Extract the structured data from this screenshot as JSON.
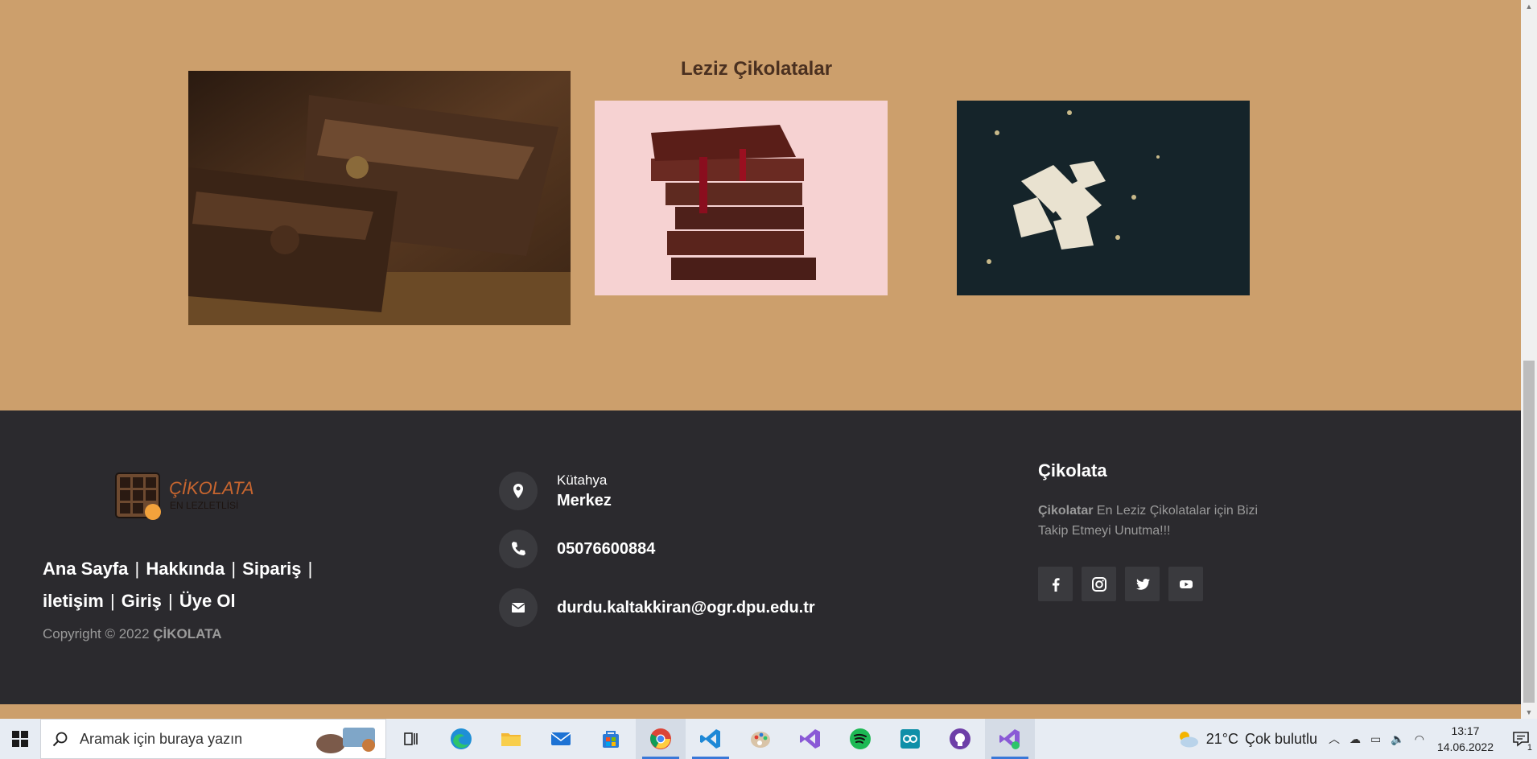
{
  "gallery": {
    "title": "Leziz Çikolatalar"
  },
  "footer": {
    "logo": {
      "brand_text": "ÇİKOLATA",
      "tagline": "EN LEZLETLİSİ"
    },
    "links": [
      "Ana Sayfa",
      "Hakkında",
      "Sipariş",
      "iletişim",
      "Giriş",
      "Üye Ol"
    ],
    "separator": "|",
    "copyright_prefix": "Copyright © 2022",
    "copyright_brand": "ÇİKOLATA",
    "contact": {
      "city": "Kütahya",
      "district": "Merkez",
      "phone": "05076600884",
      "email": "durdu.kaltakkiran@ogr.dpu.edu.tr"
    },
    "about": {
      "title": "Çikolata",
      "text_bold": "Çikolatar",
      "text_rest": " En Leziz Çikolatalar için Bizi Takip Etmeyi Unutma!!!"
    },
    "socials": [
      {
        "name": "facebook-icon"
      },
      {
        "name": "instagram-icon"
      },
      {
        "name": "twitter-icon"
      },
      {
        "name": "youtube-icon"
      }
    ]
  },
  "taskbar": {
    "search_placeholder": "Aramak için buraya yazın",
    "weather_temp": "21°C",
    "weather_text": "Çok bulutlu",
    "time": "13:17",
    "date": "14.06.2022",
    "notification_count": "1"
  },
  "colors": {
    "page_bg": "#cc9f6c",
    "footer_bg": "#2b2a2e",
    "title": "#4a3020"
  }
}
